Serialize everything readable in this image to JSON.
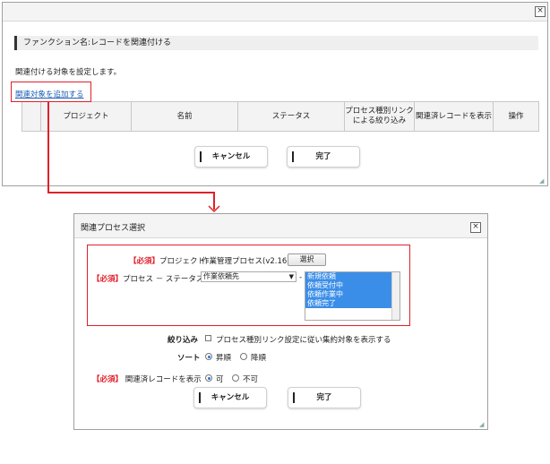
{
  "top_dialog": {
    "section_title": "ファンクション名:レコードを関連付ける",
    "description": "関連付ける対象を設定します。",
    "add_link": "関連対象を追加する",
    "columns": [
      "プロジェクト",
      "名前",
      "ステータス",
      "プロセス種別リンクによる絞り込み",
      "関連済レコードを表示",
      "操作"
    ],
    "cancel_label": "キャンセル",
    "done_label": "完了"
  },
  "bottom_dialog": {
    "title": "関連プロセス選択",
    "required": "【必須】",
    "project_label": "プロジェクト",
    "project_value": "作業管理プロセス(v2.16)",
    "select_button": "選択",
    "process_status_label": "プロセス － ステータス",
    "process_value": "作業依頼先",
    "dash": "-",
    "status_options": [
      "新規依頼",
      "依頼受付中",
      "依頼作業中",
      "依頼完了"
    ],
    "filter_label": "絞り込み",
    "filter_text": "プロセス種別リンク設定に従い集約対象を表示する",
    "sort_label": "ソート",
    "sort_asc": "昇順",
    "sort_desc": "降順",
    "show_related_label": "関連済レコードを表示",
    "show_yes": "可",
    "show_no": "不可",
    "cancel_label": "キャンセル",
    "done_label": "完了"
  },
  "colors": {
    "highlight": "#e0202a",
    "selected_option": "#3b8ee8",
    "link": "#1a5fb4"
  }
}
